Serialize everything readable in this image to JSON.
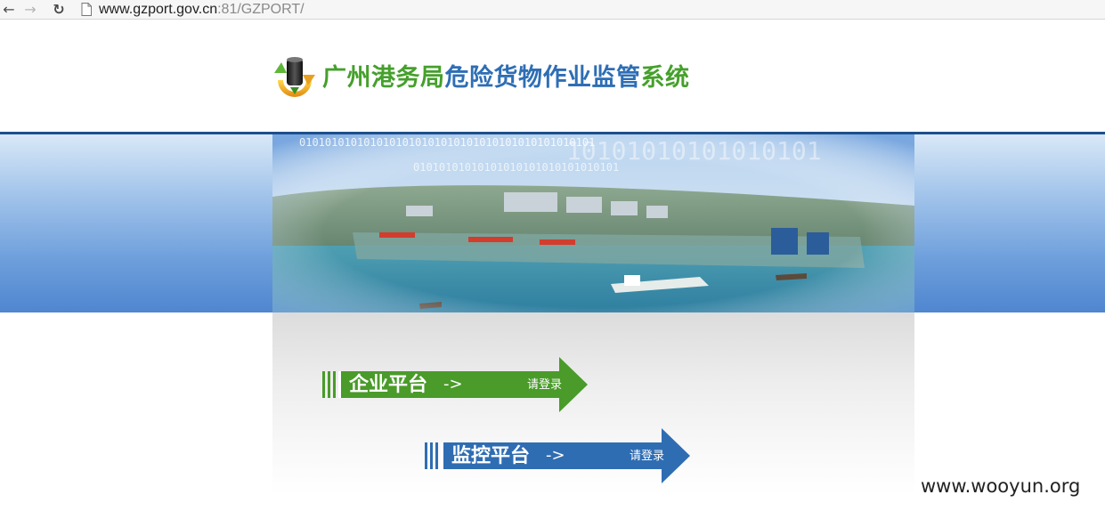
{
  "browser": {
    "back_icon": "arrow-left-icon",
    "forward_icon": "arrow-right-icon",
    "reload_icon": "reload-icon",
    "url_host": "www.gzport.gov.cn",
    "url_rest": ":81/GZPORT/"
  },
  "header": {
    "title_part1": "广州港务局",
    "title_part2": "危险货物作业监管",
    "title_part3": "系统",
    "logo_icon": "oil-barrel-logo-icon"
  },
  "banner": {
    "binary_text_1": "0101010101010101010101010101010101010101010101",
    "binary_text_2": "01010101010101010101010101010101",
    "binary_text_large": "10101010101010101"
  },
  "platforms": [
    {
      "label": "企业平台",
      "arrow": "->",
      "login": "请登录",
      "color": "#4a9b2a"
    },
    {
      "label": "监控平台",
      "arrow": "->",
      "login": "请登录",
      "color": "#2f6db3"
    }
  ],
  "watermark": "www.wooyun.org",
  "colors": {
    "green": "#45a02c",
    "blue": "#2e6eb5",
    "banner_line": "#1d4f8a"
  }
}
